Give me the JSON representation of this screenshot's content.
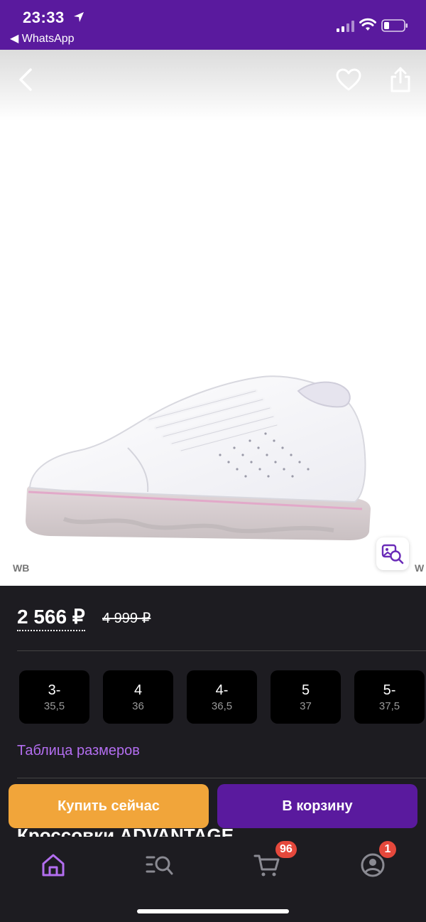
{
  "status_bar": {
    "time": "23:33",
    "back_app": "◀ WhatsApp"
  },
  "hero": {
    "watermark_left": "WB",
    "watermark_right": "W"
  },
  "price": {
    "current": "2 566 ₽",
    "old": "4 999 ₽"
  },
  "sizes": [
    {
      "ru": "3-",
      "eu": "35,5"
    },
    {
      "ru": "4",
      "eu": "36"
    },
    {
      "ru": "4-",
      "eu": "36,5"
    },
    {
      "ru": "5",
      "eu": "37"
    },
    {
      "ru": "5-",
      "eu": "37,5"
    }
  ],
  "size_table_link": "Таблица размеров",
  "product_title_peek": "Кроссовки ADVANTAGE",
  "actions": {
    "buy_now": "Купить сейчас",
    "add_to_cart": "В корзину"
  },
  "tabbar": {
    "cart_badge": "96",
    "profile_badge": "1"
  },
  "colors": {
    "brand_purple": "#5a1a9e",
    "buy_orange": "#f1a53a",
    "link_purple": "#b36ef0",
    "badge_red": "#e5483c",
    "dark_bg": "#1d1c21"
  },
  "icons": [
    "location-arrow-icon",
    "signal-icon",
    "wifi-icon",
    "battery-icon",
    "back-chevron-icon",
    "heart-icon",
    "share-icon",
    "image-search-icon",
    "home-icon",
    "catalog-search-icon",
    "cart-icon",
    "profile-icon"
  ]
}
